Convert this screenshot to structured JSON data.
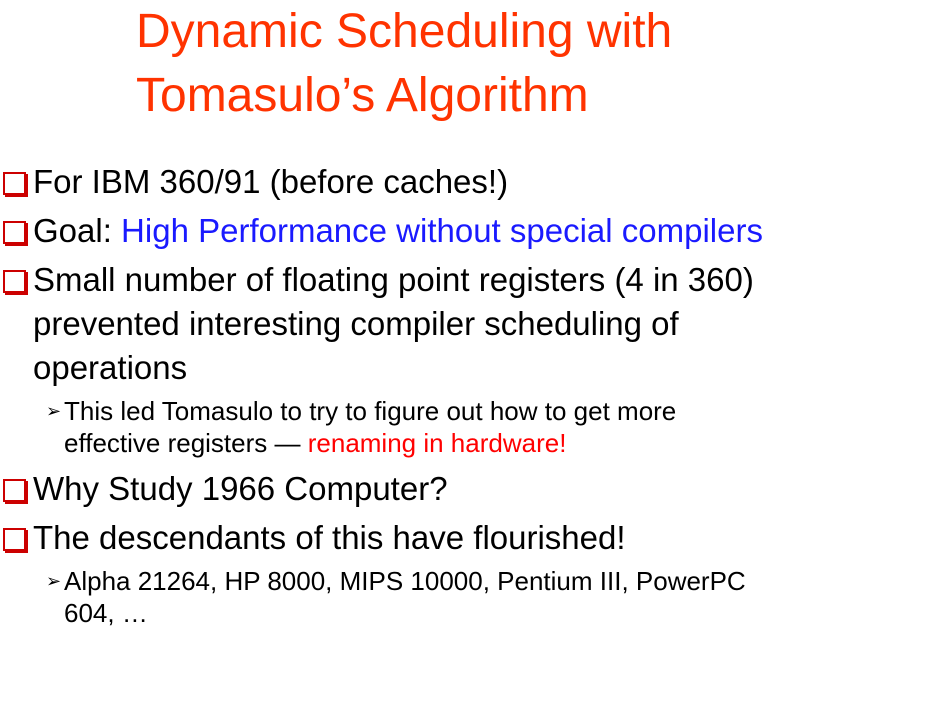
{
  "title": {
    "line1": "Dynamic Scheduling with",
    "line2": "Tomasulo’s Algorithm"
  },
  "bullets": {
    "b1": "For IBM 360/91 (before caches!)",
    "b2_prefix": "Goal: ",
    "b2_highlight": "High Performance without special compilers",
    "b3_line1": "Small number of floating point registers (4 in 360)",
    "b3_line2": "prevented interesting compiler scheduling of",
    "b3_line3": "operations",
    "b3_sub_line1": "This led Tomasulo to try to figure out how to get more",
    "b3_sub_line2_prefix": "effective registers — ",
    "b3_sub_line2_highlight": "renaming in hardware!",
    "b4": "Why Study 1966 Computer?",
    "b5": "The descendants of this have flourished!",
    "b5_sub_line1": "Alpha 21264, HP 8000, MIPS 10000, Pentium III, PowerPC",
    "b5_sub_line2": "604, …"
  },
  "colors": {
    "title": "#ff3300",
    "highlight_blue": "#1a1aff",
    "highlight_red": "#ff0000",
    "bullet_box": "#cc0000"
  },
  "icons": {
    "level1_bullet": "hollow-square-icon",
    "level2_bullet": "arrowhead-icon"
  }
}
